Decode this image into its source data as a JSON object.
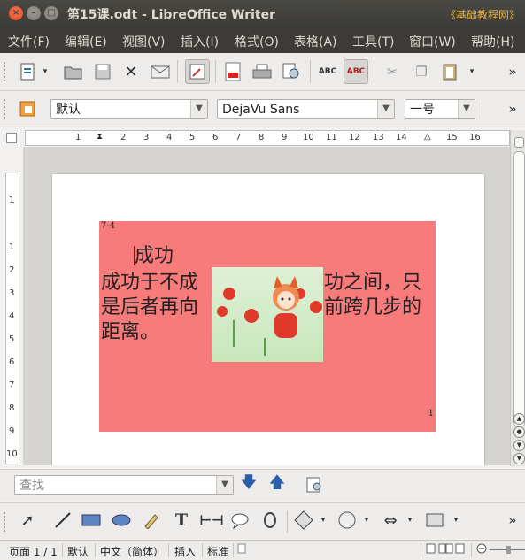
{
  "window": {
    "title": "第15课.odt - LibreOffice Writer",
    "watermark": "《基础教程网》",
    "close": "×",
    "min": "–",
    "max": "□"
  },
  "menu": [
    "文件(F)",
    "编辑(E)",
    "视图(V)",
    "插入(I)",
    "格式(O)",
    "表格(A)",
    "工具(T)",
    "窗口(W)",
    "帮助(H)"
  ],
  "format_bar": {
    "style": "默认",
    "font": "DejaVu Sans",
    "size": "一号",
    "overflow": "»"
  },
  "ruler": {
    "h_ticks": [
      "1",
      "2",
      "3",
      "4",
      "5",
      "6",
      "7",
      "8",
      "9",
      "10",
      "11",
      "12",
      "13",
      "14",
      "15",
      "16"
    ],
    "v_ticks": [
      "1",
      "1",
      "2",
      "3",
      "4",
      "5",
      "6",
      "7",
      "8",
      "9",
      "10"
    ]
  },
  "document": {
    "frame_label": "7-4",
    "heading": "成功",
    "line1_left": "成功于不成",
    "line1_right": "功之间，只",
    "line2_left": "是后者再向",
    "line2_right": "前跨几步的",
    "line3": "距离。",
    "page_number": "1",
    "frame_color": "#f77b7a"
  },
  "find": {
    "placeholder": "查找"
  },
  "drawing": {
    "text_tool": "T"
  },
  "status": {
    "page": "页面 1 / 1",
    "style": "默认",
    "language": "中文（简体）",
    "insert_mode": "插入",
    "selection_mode": "标准"
  }
}
